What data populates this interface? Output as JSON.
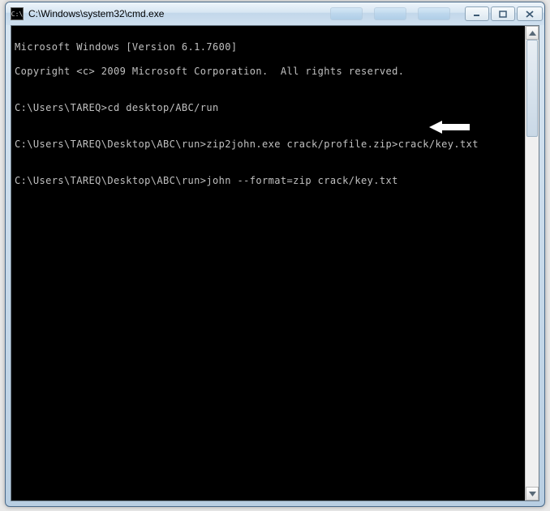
{
  "window": {
    "title": "C:\\Windows\\system32\\cmd.exe",
    "icon_label": "cmd-icon",
    "controls": {
      "minimize": "Minimize",
      "maximize": "Maximize",
      "close": "Close"
    }
  },
  "terminal": {
    "lines": [
      "Microsoft Windows [Version 6.1.7600]",
      "Copyright <c> 2009 Microsoft Corporation.  All rights reserved.",
      "",
      "C:\\Users\\TAREQ>cd desktop/ABC/run",
      "",
      "C:\\Users\\TAREQ\\Desktop\\ABC\\run>zip2john.exe crack/profile.zip>crack/key.txt",
      "",
      "C:\\Users\\TAREQ\\Desktop\\ABC\\run>john --format=zip crack/key.txt"
    ]
  },
  "annotation": {
    "arrow": "pointer-left"
  }
}
